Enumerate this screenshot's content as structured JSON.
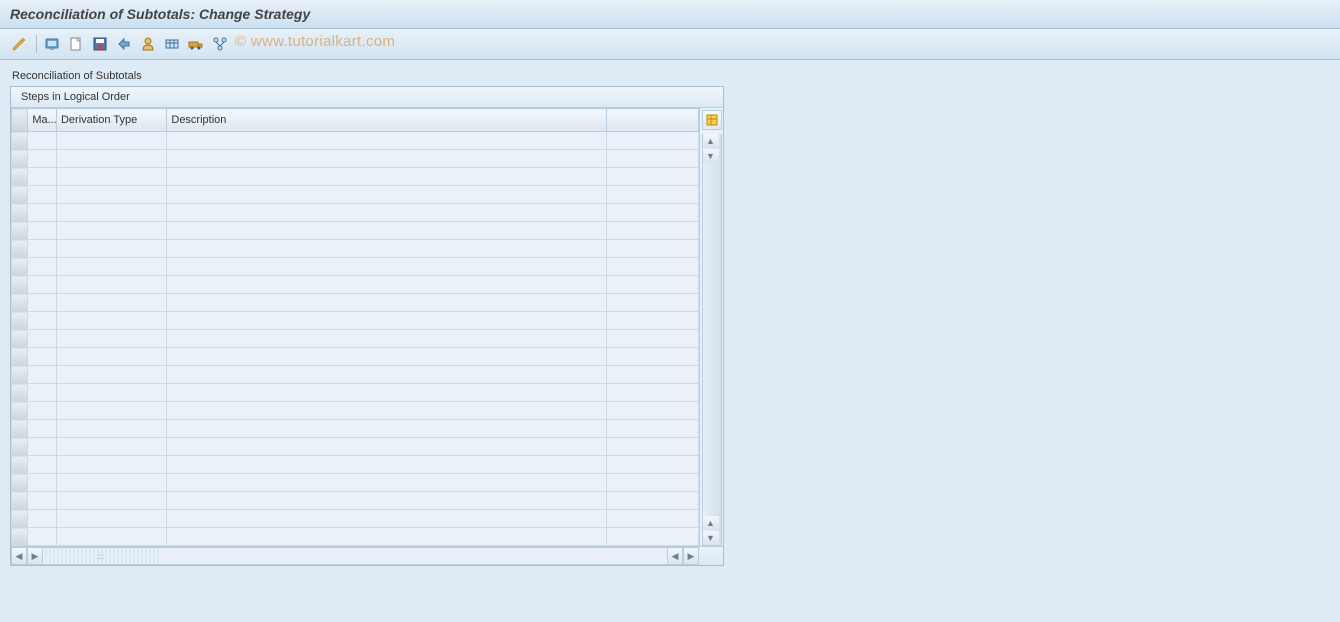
{
  "title": "Reconciliation of Subtotals: Change Strategy",
  "watermark": "© www.tutorialkart.com",
  "section_label": "Reconciliation of Subtotals",
  "panel": {
    "header": "Steps in Logical Order",
    "columns": {
      "ma": "Ma...",
      "derivation_type": "Derivation Type",
      "description": "Description"
    },
    "rows": [
      {
        "ma": "",
        "derivation_type": "",
        "description": ""
      },
      {
        "ma": "",
        "derivation_type": "",
        "description": ""
      },
      {
        "ma": "",
        "derivation_type": "",
        "description": ""
      },
      {
        "ma": "",
        "derivation_type": "",
        "description": ""
      },
      {
        "ma": "",
        "derivation_type": "",
        "description": ""
      },
      {
        "ma": "",
        "derivation_type": "",
        "description": ""
      },
      {
        "ma": "",
        "derivation_type": "",
        "description": ""
      },
      {
        "ma": "",
        "derivation_type": "",
        "description": ""
      },
      {
        "ma": "",
        "derivation_type": "",
        "description": ""
      },
      {
        "ma": "",
        "derivation_type": "",
        "description": ""
      },
      {
        "ma": "",
        "derivation_type": "",
        "description": ""
      },
      {
        "ma": "",
        "derivation_type": "",
        "description": ""
      },
      {
        "ma": "",
        "derivation_type": "",
        "description": ""
      },
      {
        "ma": "",
        "derivation_type": "",
        "description": ""
      },
      {
        "ma": "",
        "derivation_type": "",
        "description": ""
      },
      {
        "ma": "",
        "derivation_type": "",
        "description": ""
      },
      {
        "ma": "",
        "derivation_type": "",
        "description": ""
      },
      {
        "ma": "",
        "derivation_type": "",
        "description": ""
      },
      {
        "ma": "",
        "derivation_type": "",
        "description": ""
      },
      {
        "ma": "",
        "derivation_type": "",
        "description": ""
      },
      {
        "ma": "",
        "derivation_type": "",
        "description": ""
      },
      {
        "ma": "",
        "derivation_type": "",
        "description": ""
      },
      {
        "ma": "",
        "derivation_type": "",
        "description": ""
      }
    ]
  },
  "toolbar": {
    "items": [
      {
        "name": "change-icon"
      },
      {
        "name": "separator"
      },
      {
        "name": "display-icon"
      },
      {
        "name": "create-icon"
      },
      {
        "name": "save-icon"
      },
      {
        "name": "back-icon"
      },
      {
        "name": "user-icon"
      },
      {
        "name": "variant-icon"
      },
      {
        "name": "transport-icon"
      },
      {
        "name": "where-used-icon"
      }
    ]
  }
}
